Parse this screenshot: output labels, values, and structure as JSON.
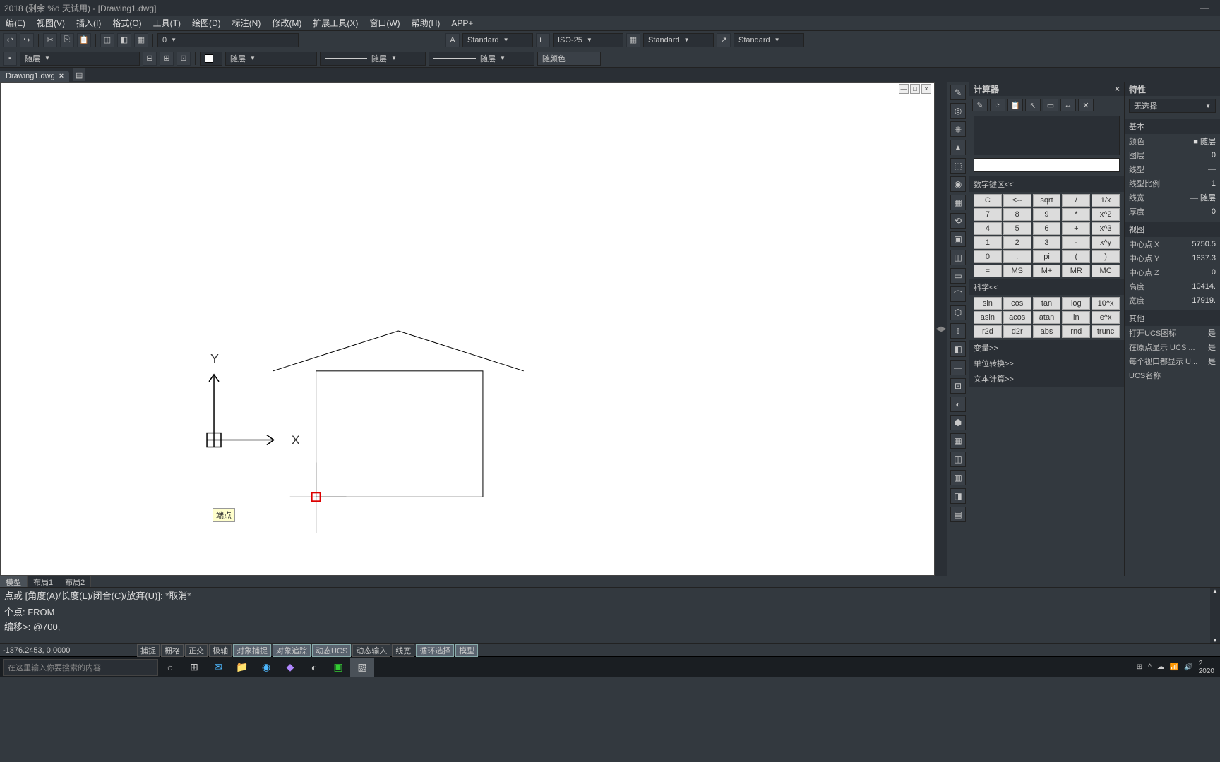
{
  "title": "2018 (剩余 %d 天试用) - [Drawing1.dwg]",
  "menu": [
    "编(E)",
    "视图(V)",
    "插入(I)",
    "格式(O)",
    "工具(T)",
    "绘图(D)",
    "标注(N)",
    "修改(M)",
    "扩展工具(X)",
    "窗口(W)",
    "帮助(H)",
    "APP+"
  ],
  "toolbar1": {
    "layer": "0",
    "style1": "Standard",
    "style2": "ISO-25",
    "style3": "Standard",
    "style4": "Standard"
  },
  "toolbar2": {
    "color_label": "随层",
    "linetype1": "随层",
    "linetype2": "随层",
    "bycolor": "随颜色"
  },
  "doc_tab": {
    "name": "Drawing1.dwg",
    "close": "×",
    "new": "▤"
  },
  "snap_tip": "端点",
  "model_tabs": [
    "模型",
    "布局1",
    "布局2"
  ],
  "cmd_history": [
    "点或 [角度(A)/长度(L)/闭合(C)/放弃(U)]: *取消*",
    "",
    "个点: FROM",
    "编移>: @700,"
  ],
  "cmd_current": "@700,",
  "status": {
    "coord": "-1376.2453, 0.0000",
    "toggles": [
      {
        "label": "捕捉",
        "on": false
      },
      {
        "label": "栅格",
        "on": false
      },
      {
        "label": "正交",
        "on": false
      },
      {
        "label": "极轴",
        "on": false
      },
      {
        "label": "对象捕捉",
        "on": true
      },
      {
        "label": "对象追踪",
        "on": true
      },
      {
        "label": "动态UCS",
        "on": true
      },
      {
        "label": "动态输入",
        "on": false
      },
      {
        "label": "线宽",
        "on": false
      },
      {
        "label": "循环选择",
        "on": true
      },
      {
        "label": "模型",
        "on": true
      }
    ]
  },
  "taskbar": {
    "search_placeholder": "在这里输入你要搜索的内容",
    "time1": "2",
    "time2": "2020"
  },
  "calc": {
    "title": "计算器",
    "sections": {
      "numpad": "数字键区<<",
      "sci": "科学<<",
      "vars": "变量>>",
      "units": "单位转换>>",
      "text": "文本计算>>"
    },
    "numpad": [
      [
        "C",
        "<--",
        "sqrt",
        "/",
        "1/x"
      ],
      [
        "7",
        "8",
        "9",
        "*",
        "x^2"
      ],
      [
        "4",
        "5",
        "6",
        "+",
        "x^3"
      ],
      [
        "1",
        "2",
        "3",
        "-",
        "x^y"
      ],
      [
        "0",
        ".",
        "pi",
        "(",
        ")"
      ],
      [
        "=",
        "MS",
        "M+",
        "MR",
        "MC"
      ]
    ],
    "sci": [
      [
        "sin",
        "cos",
        "tan",
        "log",
        "10^x"
      ],
      [
        "asin",
        "acos",
        "atan",
        "ln",
        "e^x"
      ],
      [
        "r2d",
        "d2r",
        "abs",
        "rnd",
        "trunc"
      ]
    ]
  },
  "props": {
    "title": "特性",
    "selection": "无选择",
    "sections": {
      "basic": "基本",
      "basic_rows": [
        {
          "k": "颜色",
          "v": "■ 随层"
        },
        {
          "k": "图层",
          "v": "0"
        },
        {
          "k": "线型",
          "v": "—"
        },
        {
          "k": "线型比例",
          "v": "1"
        },
        {
          "k": "线宽",
          "v": "— 随层"
        },
        {
          "k": "厚度",
          "v": "0"
        }
      ],
      "view": "视图",
      "view_rows": [
        {
          "k": "中心点 X",
          "v": "5750.5"
        },
        {
          "k": "中心点 Y",
          "v": "1637.3"
        },
        {
          "k": "中心点 Z",
          "v": "0"
        },
        {
          "k": "高度",
          "v": "10414."
        },
        {
          "k": "宽度",
          "v": "17919."
        }
      ],
      "other": "其他",
      "other_rows": [
        {
          "k": "打开UCS图标",
          "v": "是"
        },
        {
          "k": "在原点显示 UCS ...",
          "v": "是"
        },
        {
          "k": "每个视口都显示 U...",
          "v": "是"
        },
        {
          "k": "UCS名称",
          "v": ""
        }
      ]
    }
  },
  "palette_icons": [
    "✎",
    "◎",
    "⎈",
    "▲",
    "⬚",
    "◉",
    "▦",
    "⟲",
    "▣",
    "◫",
    "▭",
    "⌒",
    "⬡",
    "⟟",
    "◧",
    "—",
    "⊡",
    "◐",
    "⬢",
    "▦",
    "◫",
    "▥",
    "◨",
    "▤",
    "▧"
  ]
}
